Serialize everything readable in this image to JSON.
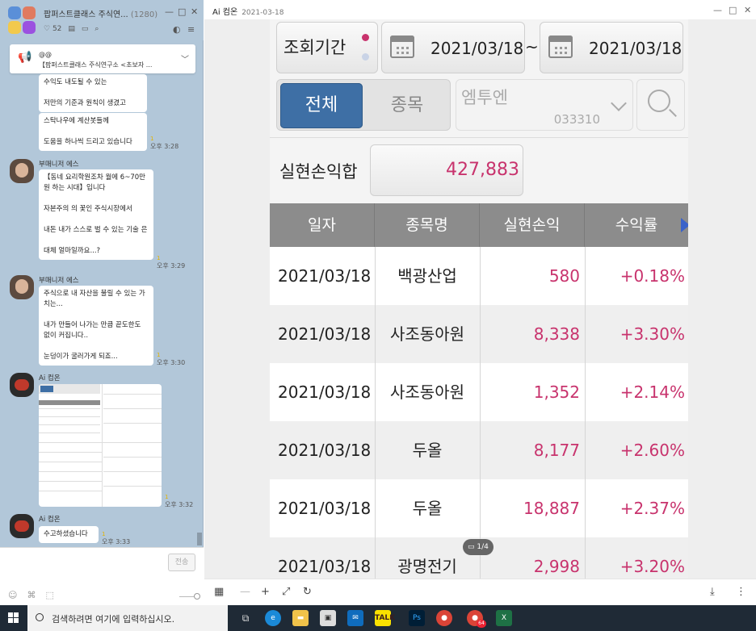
{
  "chat": {
    "title": "팝퍼스트클래스 주식연...",
    "member_count": "(1280)",
    "likes": "52",
    "notice_line1": "@@",
    "notice_line2": "【팝퍼스트클래스 주식연구소 <초보자 ...",
    "messages": [
      {
        "text": "수익도 내도될 수 있는\n\n저만의 기준과 원칙이 생겼고"
      },
      {
        "text": "스탁나우에 계산봇들께\n\n도움을 하나씩 드리고 있습니다",
        "time": "오후 3:28"
      },
      {
        "sender": "부매니저 에스",
        "text": "【동네 요리학원조차 월에 6~70만원 하는 시대】입니다\n\n자본주의 의 꽃인 주식시장에서\n\n내돈 내가 스스로 벌 수 있는 기술 은\n\n대체 얼마일까요...?",
        "time": "오후 3:29"
      },
      {
        "sender": "부매니저 에스",
        "text": "주식으로 내 자산을 불릴 수 있는 가치는...\n\n내가 만들어 나가는 만큼 끝도한도 없이 커집니다..\n\n눈덩이가 굴러가게 되죠...",
        "time": "오후 3:30"
      },
      {
        "sender": "Ai 컴온",
        "time": "오후 3:32"
      },
      {
        "sender": "Ai 컴온",
        "text": "수고하셨습니다",
        "time": "오후 3:33"
      }
    ],
    "send_label": "전송"
  },
  "viewer": {
    "title": "Ai 컴온",
    "date": "2021-03-18",
    "page_indicator": "1/4"
  },
  "app": {
    "period_label": "조회기간",
    "date_from": "2021/03/18",
    "date_to": "2021/03/18",
    "tilde": "~",
    "tab_all": "전체",
    "tab_stock": "종목",
    "stock_name": "엠투엔",
    "stock_code": "033310",
    "sum_label": "실현손익합",
    "sum_value": "427,883",
    "headers": [
      "일자",
      "종목명",
      "실현손익",
      "수익률"
    ],
    "rows": [
      {
        "date": "2021/03/18",
        "name": "백광산업",
        "pnl": "580",
        "rate": "+0.18%"
      },
      {
        "date": "2021/03/18",
        "name": "사조동아원",
        "pnl": "8,338",
        "rate": "+3.30%"
      },
      {
        "date": "2021/03/18",
        "name": "사조동아원",
        "pnl": "1,352",
        "rate": "+2.14%"
      },
      {
        "date": "2021/03/18",
        "name": "두올",
        "pnl": "8,177",
        "rate": "+2.60%"
      },
      {
        "date": "2021/03/18",
        "name": "두올",
        "pnl": "18,887",
        "rate": "+2.37%"
      },
      {
        "date": "2021/03/18",
        "name": "광명전기",
        "pnl": "2,998",
        "rate": "+3.20%"
      }
    ],
    "accent_color": "#c8336d",
    "tab_color": "#3e6fa5"
  },
  "taskbar": {
    "search_placeholder": "검색하려면 여기에 입력하십시오.",
    "chrome_badge": "64"
  }
}
